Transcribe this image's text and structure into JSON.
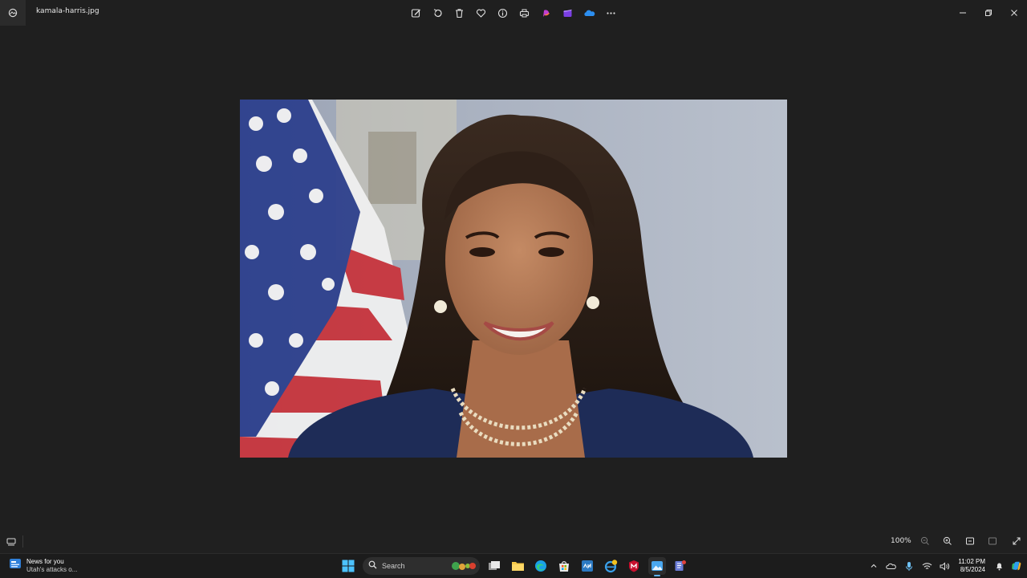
{
  "window": {
    "filename": "kamala-harris.jpg"
  },
  "toolbar": {
    "items": [
      "edit-icon",
      "rotate-icon",
      "delete-icon",
      "favorite-icon",
      "info-icon",
      "print-icon",
      "designer-icon",
      "clipchamp-icon",
      "onedrive-icon",
      "more-icon"
    ]
  },
  "statusbar": {
    "zoom_level": "100%"
  },
  "taskbar": {
    "news_title": "News for you",
    "news_subtitle": "Utah's attacks o...",
    "search_placeholder": "Search",
    "clock_time": "11:02 PM",
    "clock_date": "8/5/2024"
  },
  "colors": {
    "background": "#1f1f1f",
    "accent": "#5fb2f2",
    "jacket": "#1e2c57"
  }
}
